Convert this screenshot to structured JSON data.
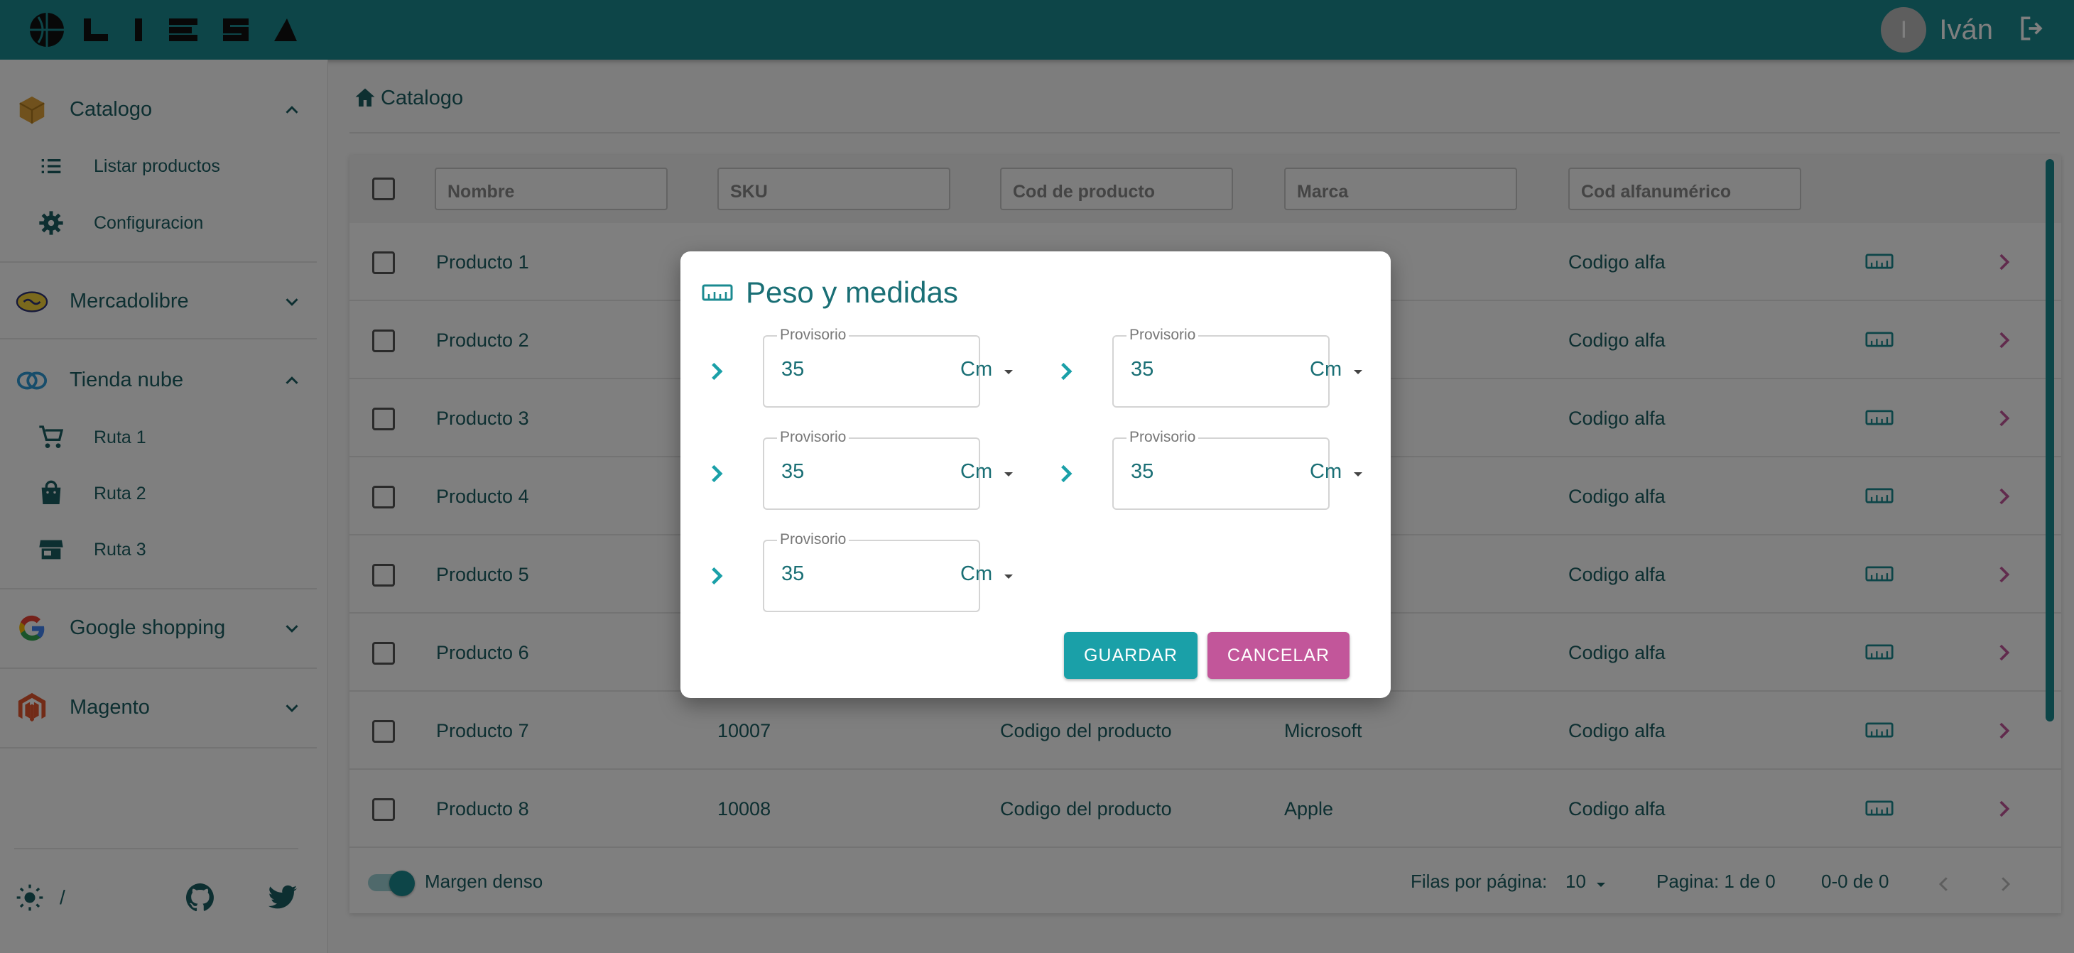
{
  "brand": {
    "name": "LIESA"
  },
  "user": {
    "initial": "I",
    "name": "Iván"
  },
  "sidebar": {
    "sections": [
      {
        "label": "Catalogo",
        "items": [
          {
            "label": "Listar productos"
          },
          {
            "label": "Configuracion"
          }
        ]
      },
      {
        "label": "Mercadolibre"
      },
      {
        "label": "Tienda nube",
        "items": [
          {
            "label": "Ruta 1"
          },
          {
            "label": "Ruta 2"
          },
          {
            "label": "Ruta 3"
          }
        ]
      },
      {
        "label": "Google shopping"
      },
      {
        "label": "Magento"
      }
    ],
    "theme_separator": "/"
  },
  "breadcrumb": {
    "label": "Catalogo"
  },
  "table": {
    "filters": [
      "Nombre",
      "SKU",
      "Cod de producto",
      "Marca",
      "Cod alfanumérico"
    ],
    "rows": [
      {
        "name": "Producto 1",
        "sku": "",
        "code": "",
        "brand": "",
        "alpha": "Codigo alfa"
      },
      {
        "name": "Producto 2",
        "sku": "",
        "code": "",
        "brand": "",
        "alpha": "Codigo alfa"
      },
      {
        "name": "Producto 3",
        "sku": "",
        "code": "",
        "brand": "",
        "alpha": "Codigo alfa"
      },
      {
        "name": "Producto 4",
        "sku": "",
        "code": "",
        "brand": "",
        "alpha": "Codigo alfa"
      },
      {
        "name": "Producto 5",
        "sku": "",
        "code": "",
        "brand": "",
        "alpha": "Codigo alfa"
      },
      {
        "name": "Producto 6",
        "sku": "",
        "code": "",
        "brand": "",
        "alpha": "Codigo alfa"
      },
      {
        "name": "Producto 7",
        "sku": "10007",
        "code": "Codigo del producto",
        "brand": "Microsoft",
        "alpha": "Codigo alfa"
      },
      {
        "name": "Producto 8",
        "sku": "10008",
        "code": "Codigo del producto",
        "brand": "Apple",
        "alpha": "Codigo alfa"
      }
    ],
    "footer": {
      "dense_label": "Margen denso",
      "rows_per_page_label": "Filas por página:",
      "rows_per_page": "10",
      "page_label": "Pagina: 1 de 0",
      "range_label": "0-0 de 0"
    }
  },
  "dialog": {
    "title": "Peso y medidas",
    "fields": [
      {
        "label": "Provisorio",
        "value": "35",
        "unit": "Cm"
      },
      {
        "label": "Provisorio",
        "value": "35",
        "unit": "Cm"
      },
      {
        "label": "Provisorio",
        "value": "35",
        "unit": "Cm"
      },
      {
        "label": "Provisorio",
        "value": "35",
        "unit": "Cm"
      },
      {
        "label": "Provisorio",
        "value": "35",
        "unit": "Cm"
      }
    ],
    "save_label": "GUARDAR",
    "cancel_label": "CANCELAR"
  },
  "colors": {
    "primary": "#1a8a90",
    "accent": "#c2569a",
    "text": "#1b5e63"
  }
}
